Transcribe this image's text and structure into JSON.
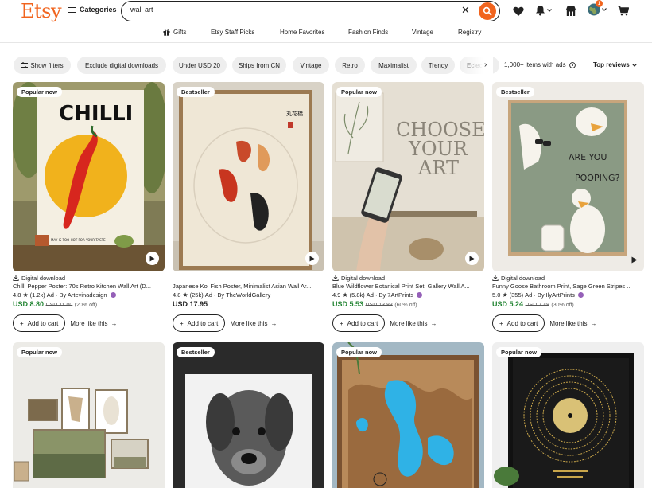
{
  "header": {
    "logo": "Etsy",
    "categories_label": "Categories",
    "search_value": "wall art",
    "notification_count": "1"
  },
  "subnav": [
    "Gifts",
    "Etsy Staff Picks",
    "Home Favorites",
    "Fashion Finds",
    "Vintage",
    "Registry"
  ],
  "filters": {
    "chips": [
      "Show filters",
      "Exclude digital downloads",
      "Under USD 20",
      "Ships from CN",
      "Vintage",
      "Retro",
      "Maximalist",
      "Trendy",
      "Eclec"
    ],
    "items_count": "1,000+ items with ads",
    "sort_label": "Top reviews"
  },
  "listings": [
    {
      "badge": "Popular now",
      "digital": "Digital download",
      "title": "Chilli Pepper Poster: 70s Retro Kitchen Wall Art (D...",
      "rating": "4.8",
      "reviews": "(1.2k)",
      "ad": "Ad",
      "by": "By Artevinadesign",
      "price": "USD 8.80",
      "was": "USD 11.00",
      "off": "(20% off)",
      "cart_label": "Add to cart",
      "more_label": "More like this",
      "poster_text": "CHILLI",
      "poster_sub": "MAY  IS TOO HOT FOR YOUR TASTE"
    },
    {
      "badge": "Bestseller",
      "digital": "",
      "title": "Japanese Koi Fish Poster, Minimalist Asian Wall Ar...",
      "rating": "4.8",
      "reviews": "(25k)",
      "ad": "Ad",
      "by": "By TheWorldGallery",
      "price": "USD 17.95",
      "was": "",
      "off": "",
      "cart_label": "Add to cart",
      "more_label": "More like this"
    },
    {
      "badge": "Popular now",
      "digital": "Digital download",
      "title": "Blue Wildflower Botanical Print Set: Gallery Wall A...",
      "rating": "4.9",
      "reviews": "(5.8k)",
      "ad": "Ad",
      "by": "By 7ArtPrints",
      "price": "USD 5.53",
      "was": "USD 13.83",
      "off": "(60% off)",
      "cart_label": "Add to cart",
      "more_label": "More like this",
      "poster_lines": [
        "CHOOSE",
        "YOUR",
        "ART"
      ]
    },
    {
      "badge": "Bestseller",
      "digital": "Digital download",
      "title": "Funny Goose Bathroom Print, Sage Green Stripes ...",
      "rating": "5.0",
      "reviews": "(355)",
      "ad": "Ad",
      "by": "By IlyArtPrints",
      "price": "USD 5.24",
      "was": "USD 7.48",
      "off": "(30% off)",
      "cart_label": "Add to cart",
      "more_label": "More like this",
      "poster_lines": [
        "ARE YOU",
        "POOPING?"
      ]
    },
    {
      "badge": "Popular now"
    },
    {
      "badge": "Bestseller"
    },
    {
      "badge": "Popular now"
    },
    {
      "badge": "Popular now"
    }
  ],
  "colors": {
    "brand": "#f1641e",
    "sale_price": "#258635",
    "star_seller": "#9560b8"
  }
}
